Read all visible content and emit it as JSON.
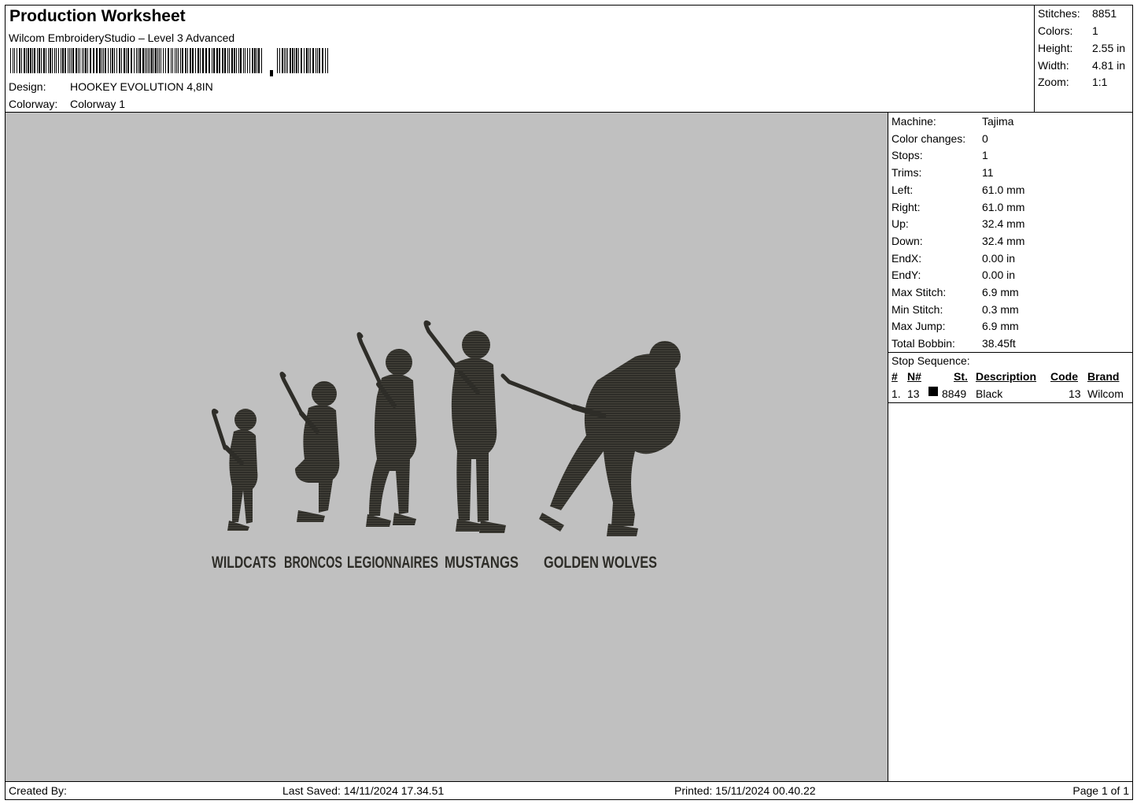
{
  "header": {
    "title": "Production Worksheet",
    "software": "Wilcom EmbroideryStudio – Level 3 Advanced",
    "design_label": "Design:",
    "design_value": "HOOKEY EVOLUTION 4,8IN",
    "colorway_label": "Colorway:",
    "colorway_value": "Colorway 1"
  },
  "stats": [
    {
      "label": "Stitches:",
      "value": "8851"
    },
    {
      "label": "Colors:",
      "value": "1"
    },
    {
      "label": "Height:",
      "value": "2.55 in"
    },
    {
      "label": "Width:",
      "value": "4.81 in"
    },
    {
      "label": "Zoom:",
      "value": "1:1"
    }
  ],
  "machine_info": [
    {
      "label": "Machine:",
      "value": "Tajima"
    },
    {
      "label": "Color changes:",
      "value": "0"
    },
    {
      "label": "Stops:",
      "value": "1"
    },
    {
      "label": "Trims:",
      "value": "11"
    },
    {
      "label": "Left:",
      "value": "61.0 mm"
    },
    {
      "label": "Right:",
      "value": "61.0 mm"
    },
    {
      "label": "Up:",
      "value": "32.4 mm"
    },
    {
      "label": "Down:",
      "value": "32.4 mm"
    },
    {
      "label": "EndX:",
      "value": "0.00 in"
    },
    {
      "label": "EndY:",
      "value": "0.00 in"
    },
    {
      "label": "Max Stitch:",
      "value": "6.9 mm"
    },
    {
      "label": "Min Stitch:",
      "value": "0.3 mm"
    },
    {
      "label": "Max Jump:",
      "value": "6.9 mm"
    },
    {
      "label": "Total Bobbin:",
      "value": "38.45ft"
    }
  ],
  "stop_sequence": {
    "title": "Stop Sequence:",
    "headers": {
      "num": "#",
      "n": "N#",
      "st": "St.",
      "description": "Description",
      "code": "Code",
      "brand": "Brand"
    },
    "rows": [
      {
        "num": "1.",
        "n": "13",
        "swatch_color": "#000000",
        "st": "8849",
        "description": "Black",
        "code": "13",
        "brand": "Wilcom"
      }
    ]
  },
  "design_labels": [
    "WILDCATS",
    "BRONCOS",
    "LEGIONNAIRES",
    "MUSTANGS",
    "GOLDEN WOLVES"
  ],
  "colors": {
    "thread": "#2e2d28",
    "canvas_bg": "#c0c0c0"
  },
  "footer": {
    "created_by": "Created By:",
    "last_saved": "Last Saved: 14/11/2024 17.34.51",
    "printed": "Printed: 15/11/2024 00.40.22",
    "page": "Page 1 of 1"
  }
}
